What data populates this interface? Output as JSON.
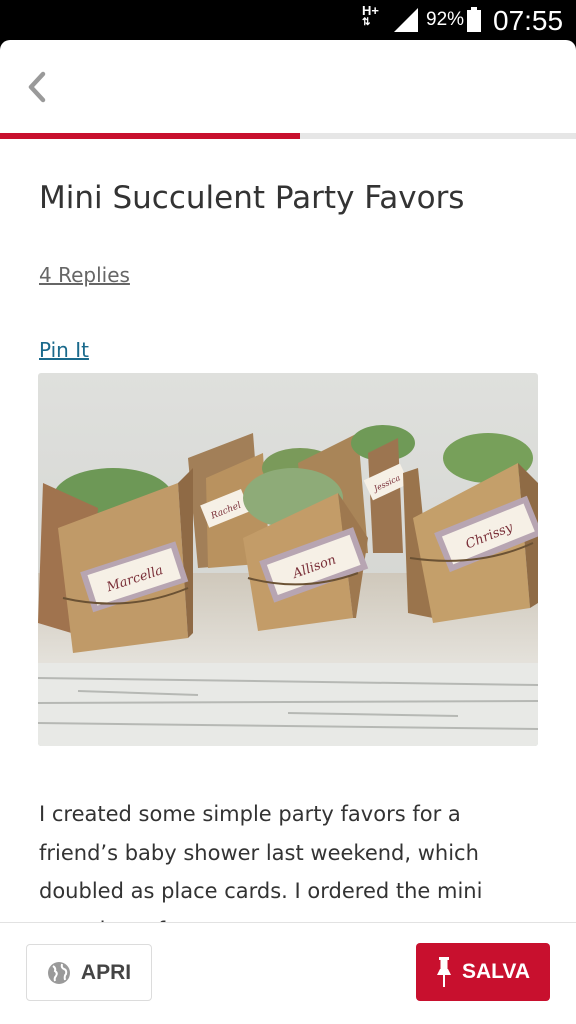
{
  "status_bar": {
    "network": "H+",
    "battery_percent": "92%",
    "battery_level": 0.92,
    "time": "07:55"
  },
  "reading_progress": 0.52,
  "article": {
    "title": "Mini Succulent Party Favors",
    "replies_link": "4 Replies",
    "pin_link": "Pin It",
    "image_name_tags": [
      "Marcella",
      "Rachel",
      "Allison",
      "Jessica",
      "Chrissy"
    ],
    "body_text": "I created some simple party favors for a friend’s baby shower last weekend, which doubled as place cards. I ordered the mini succulents from"
  },
  "bottom_bar": {
    "open_label": "APRI",
    "save_label": "SALVA",
    "accent_color": "#c8102e"
  },
  "icons": {
    "back": "chevron-left-icon",
    "open": "globe-icon",
    "save": "pushpin-icon"
  }
}
